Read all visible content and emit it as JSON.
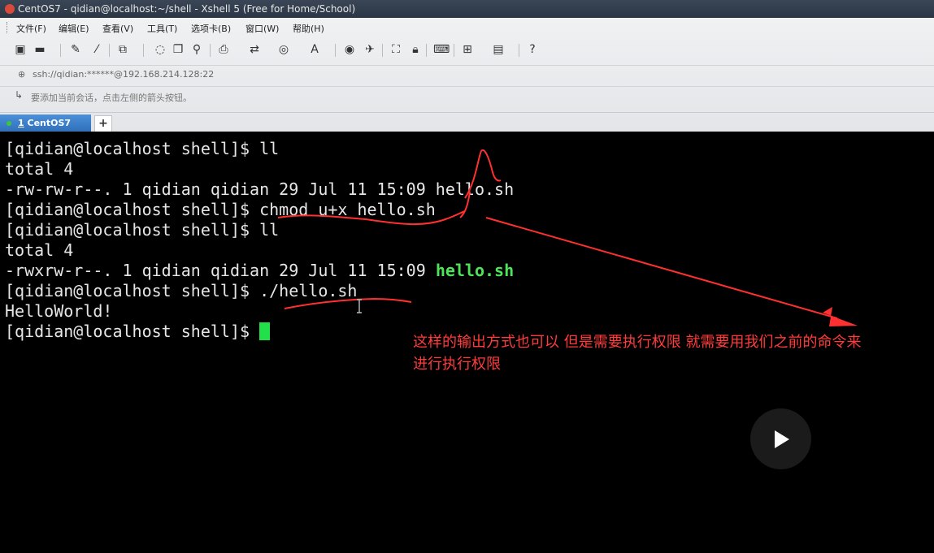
{
  "window": {
    "title": "CentOS7 - qidian@localhost:~/shell - Xshell 5 (Free for Home/School)"
  },
  "menu": [
    {
      "label": "文件(F)"
    },
    {
      "label": "编辑(E)"
    },
    {
      "label": "查看(V)"
    },
    {
      "label": "工具(T)"
    },
    {
      "label": "选项卡(B)"
    },
    {
      "label": "窗口(W)"
    },
    {
      "label": "帮助(H)"
    }
  ],
  "toolbar": {
    "icons": [
      "new-session-icon",
      "open-folder-icon",
      "properties-icon",
      "reconnect-icon",
      "new-tab-icon",
      "copy-icon",
      "find-icon",
      "print-icon",
      "transfer-icon",
      "globe-icon",
      "font-icon",
      "xftp-icon",
      "script-icon",
      "fullscreen-icon",
      "lock-icon",
      "keyboard-icon",
      "compose-icon",
      "layout-icon",
      "help-icon"
    ]
  },
  "address": {
    "value": "ssh://qidian:******@192.168.214.128:22"
  },
  "hint": {
    "text": "要添加当前会话，点击左侧的箭头按钮。"
  },
  "tabs": [
    {
      "number": "1",
      "label": "CentOS7"
    }
  ],
  "terminal": {
    "prompt": "[qidian@localhost shell]$ ",
    "lines": [
      {
        "text": "[qidian@localhost shell]$ ll"
      },
      {
        "text": "total 4"
      },
      {
        "text": "-rw-rw-r--. 1 qidian qidian 29 Jul 11 15:09 hello.sh"
      },
      {
        "text": "[qidian@localhost shell]$ chmod u+x hello.sh"
      },
      {
        "text": "[qidian@localhost shell]$ ll"
      },
      {
        "text": "total 4"
      },
      {
        "text": "-rwxrw-r--. 1 qidian qidian 29 Jul 11 15:09 ",
        "highlight": "hello.sh"
      },
      {
        "text": "[qidian@localhost shell]$ ./hello.sh"
      },
      {
        "text": "HelloWorld!"
      }
    ]
  },
  "annotation": {
    "line1": "这样的输出方式也可以  但是需要执行权限  就需要用我们之前的命令来",
    "line2": "进行执行权限"
  },
  "colors": {
    "annotation": "#ff3b3b",
    "executable": "#4fe35a",
    "cursor": "#22e04a",
    "tab": "#2f6fb8"
  }
}
